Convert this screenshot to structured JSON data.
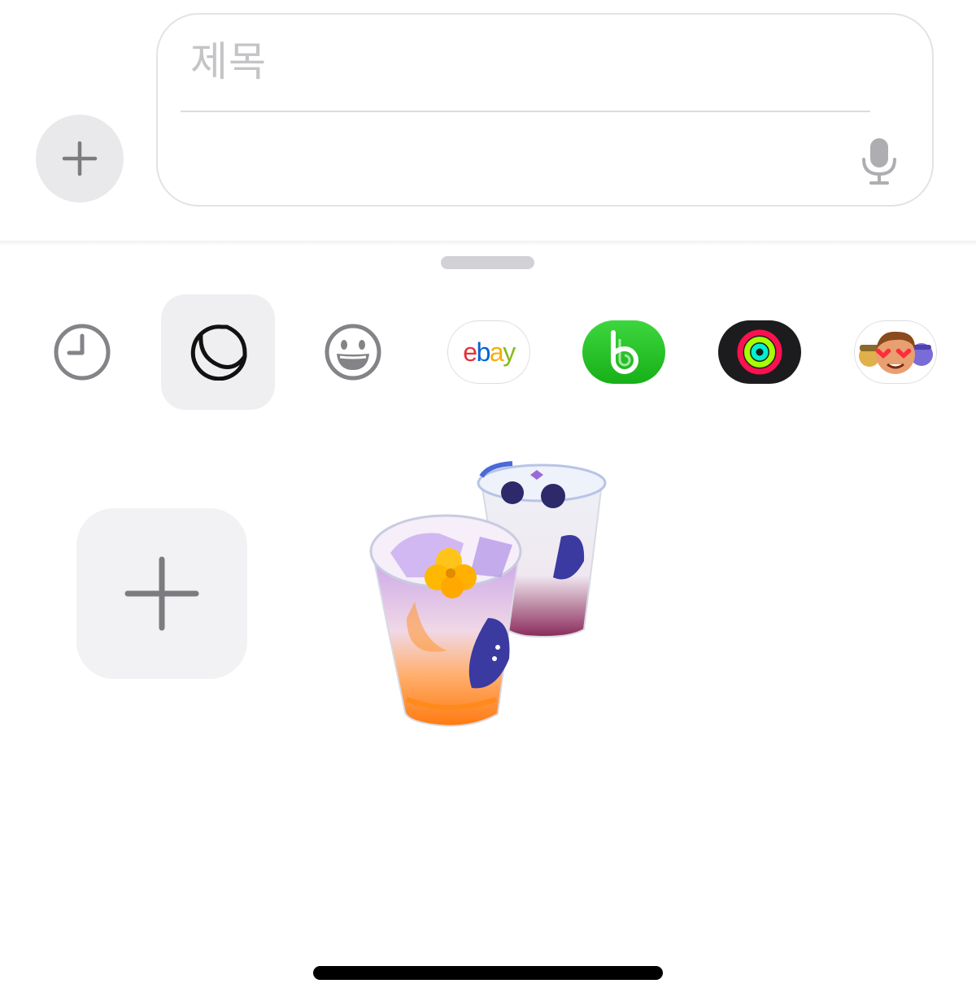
{
  "composer": {
    "subject_placeholder": "제목",
    "body_value": "",
    "icons": {
      "plus": "plus-icon",
      "mic": "microphone-icon"
    }
  },
  "drawer": {
    "apps": [
      {
        "name": "recents",
        "icon": "clock-icon"
      },
      {
        "name": "stickers",
        "icon": "sticker-icon",
        "selected": true
      },
      {
        "name": "emoji",
        "icon": "smiley-icon"
      },
      {
        "name": "ebay",
        "icon": "ebay-logo",
        "logo_text": "ebay"
      },
      {
        "name": "bump",
        "icon": "bump-logo"
      },
      {
        "name": "fitness",
        "icon": "activity-rings-icon"
      },
      {
        "name": "memoji",
        "icon": "memoji-icon"
      }
    ],
    "add_sticker_icon": "plus-icon",
    "stickers": [
      {
        "name": "iced-drinks-sticker"
      }
    ]
  },
  "colors": {
    "background": "#ffffff",
    "pill_gray": "#e9e9eb",
    "placeholder": "#c4c4c7",
    "selected_tab": "#efeff1",
    "bump_green": "#2ec52e",
    "fitness_bg": "#1c1c1e"
  }
}
